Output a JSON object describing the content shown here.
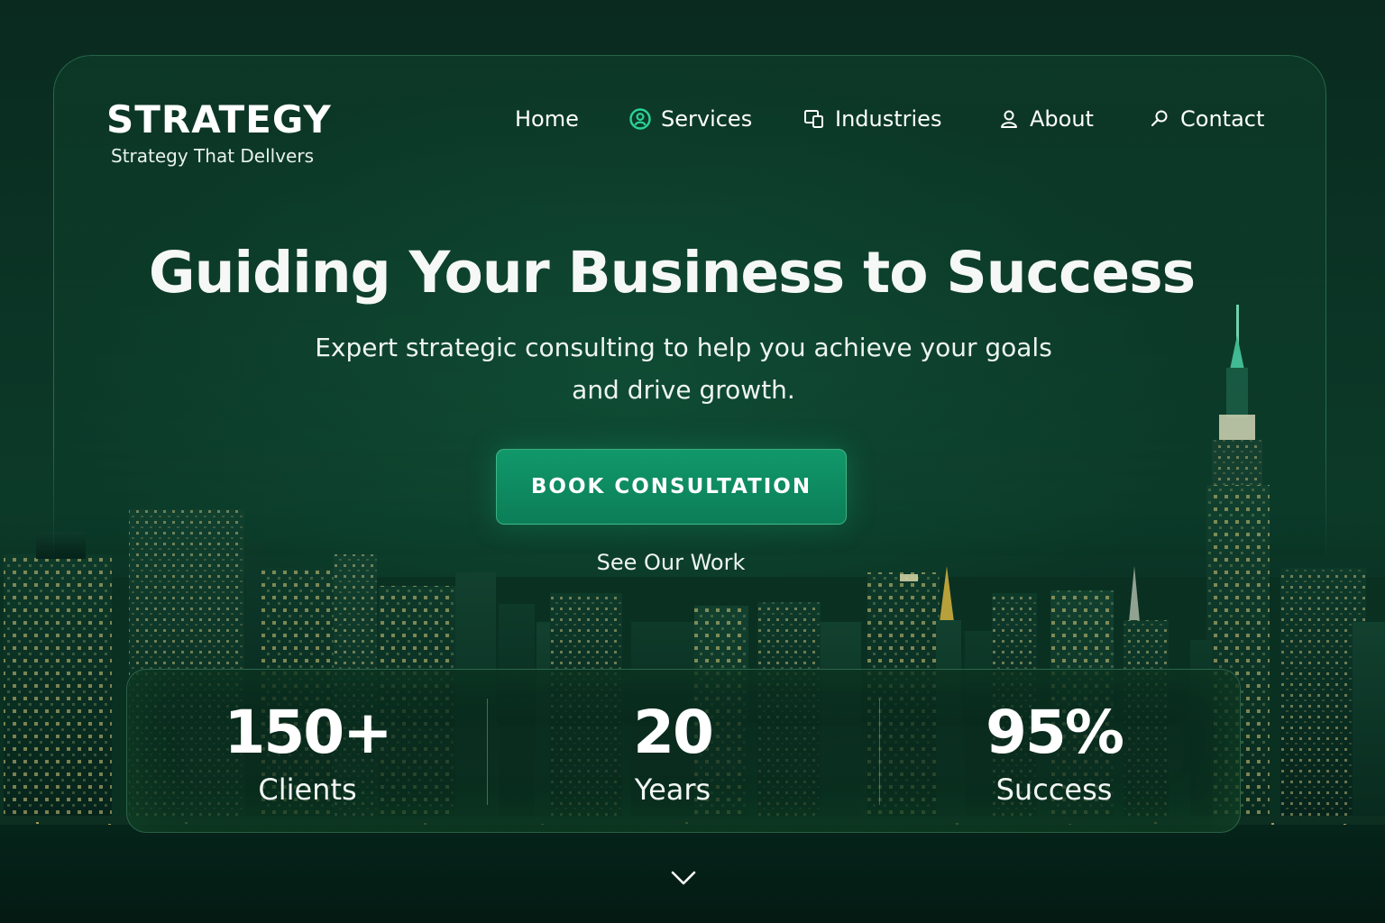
{
  "brand": {
    "title": "STRATEGY",
    "tagline": "Strategy That Dellvers"
  },
  "nav": {
    "items": [
      {
        "label": "Home",
        "icon": ""
      },
      {
        "label": "Services",
        "icon": "person-circle-icon"
      },
      {
        "label": "Industries",
        "icon": "devices-icon"
      },
      {
        "label": "About",
        "icon": "user-icon"
      },
      {
        "label": "Contact",
        "icon": "search-icon"
      }
    ]
  },
  "hero": {
    "title": "Guiding Your Business to Success",
    "subtitle_line1": "Expert strategic consulting to help you achieve your goals",
    "subtitle_line2": "and drive growth.",
    "cta_label": "BOOK CONSULTATION",
    "secondary_label": "See Our Work"
  },
  "stats": [
    {
      "value": "150+",
      "label": "Clients"
    },
    {
      "value": "20",
      "label": "Years"
    },
    {
      "value": "95%",
      "label": "Success"
    }
  ],
  "colors": {
    "background": "#0b3526",
    "accent": "#11986b",
    "icon_accent": "#2bd39a"
  },
  "scroll_indicator": "chevron-down-icon"
}
